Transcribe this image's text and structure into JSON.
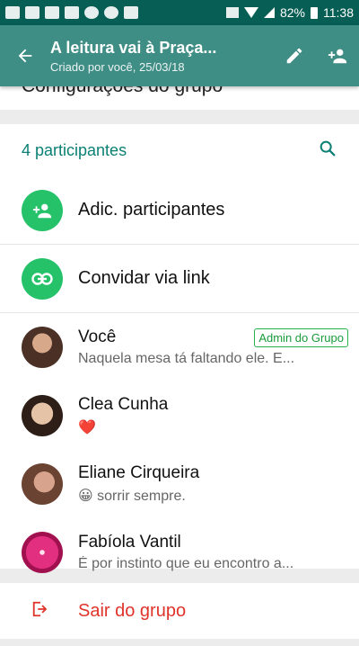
{
  "status_bar": {
    "battery": "82%",
    "time": "11:38"
  },
  "toolbar": {
    "title": "A leitura vai à Praça...",
    "subtitle": "Criado por você, 25/03/18",
    "icons": {
      "back": "arrow-back-icon",
      "edit": "pencil-icon",
      "add_person": "person-add-icon"
    }
  },
  "behind_header": {
    "text": "Configurações do grupo"
  },
  "participants": {
    "title": "4 participantes",
    "search_icon": "search-icon",
    "actions": [
      {
        "label": "Adic. participantes",
        "icon": "person-add-icon"
      },
      {
        "label": "Convidar via link",
        "icon": "link-icon"
      }
    ],
    "members": [
      {
        "name": "Você",
        "badge": "Admin do Grupo",
        "status": "Naquela mesa tá faltando ele. E..."
      },
      {
        "name": "Clea Cunha",
        "badge": "",
        "status": "❤️"
      },
      {
        "name": "Eliane Cirqueira",
        "badge": "",
        "status": "😀 sorrir sempre."
      },
      {
        "name": "Fabíola Vantil",
        "badge": "",
        "status": "É por instinto que eu encontro a..."
      }
    ]
  },
  "leave": {
    "label": "Sair do grupo",
    "icon": "exit-icon"
  },
  "colors": {
    "accent": "#0a7f73",
    "toolbar": "#3f8e85",
    "green": "#25c26a",
    "danger": "#e0342a"
  }
}
